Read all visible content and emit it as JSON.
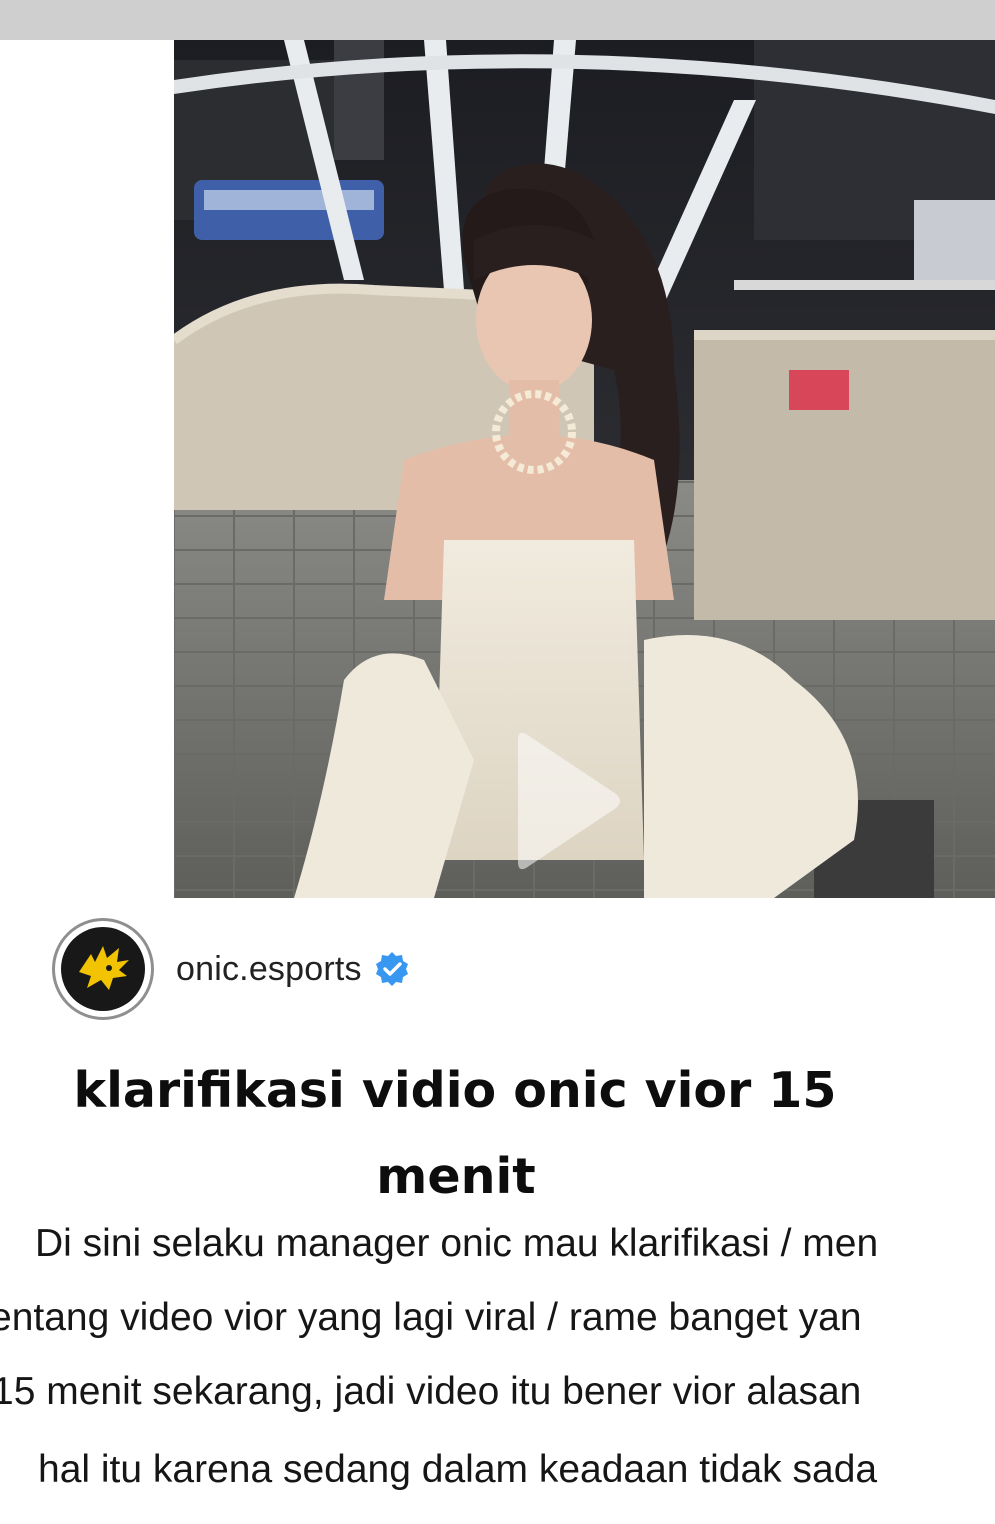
{
  "post": {
    "account_name": "onic.esports",
    "verified": true,
    "accent_color": "#3897f0",
    "avatar_icon": "onic-hedgehog-logo-icon",
    "media_type": "video",
    "media_overlay_icon": "play-icon"
  },
  "headline": {
    "line1": "klarifikasi vidio onic vior 15",
    "line2": "menit"
  },
  "body": {
    "lines": [
      "Di sini selaku manager onic mau klarifikasi / men",
      "entang video vior yang lagi viral / rame banget yan",
      "15 menit sekarang, jadi video itu bener vior alasan",
      "hal itu karena sedang dalam keadaan tidak sada"
    ]
  }
}
